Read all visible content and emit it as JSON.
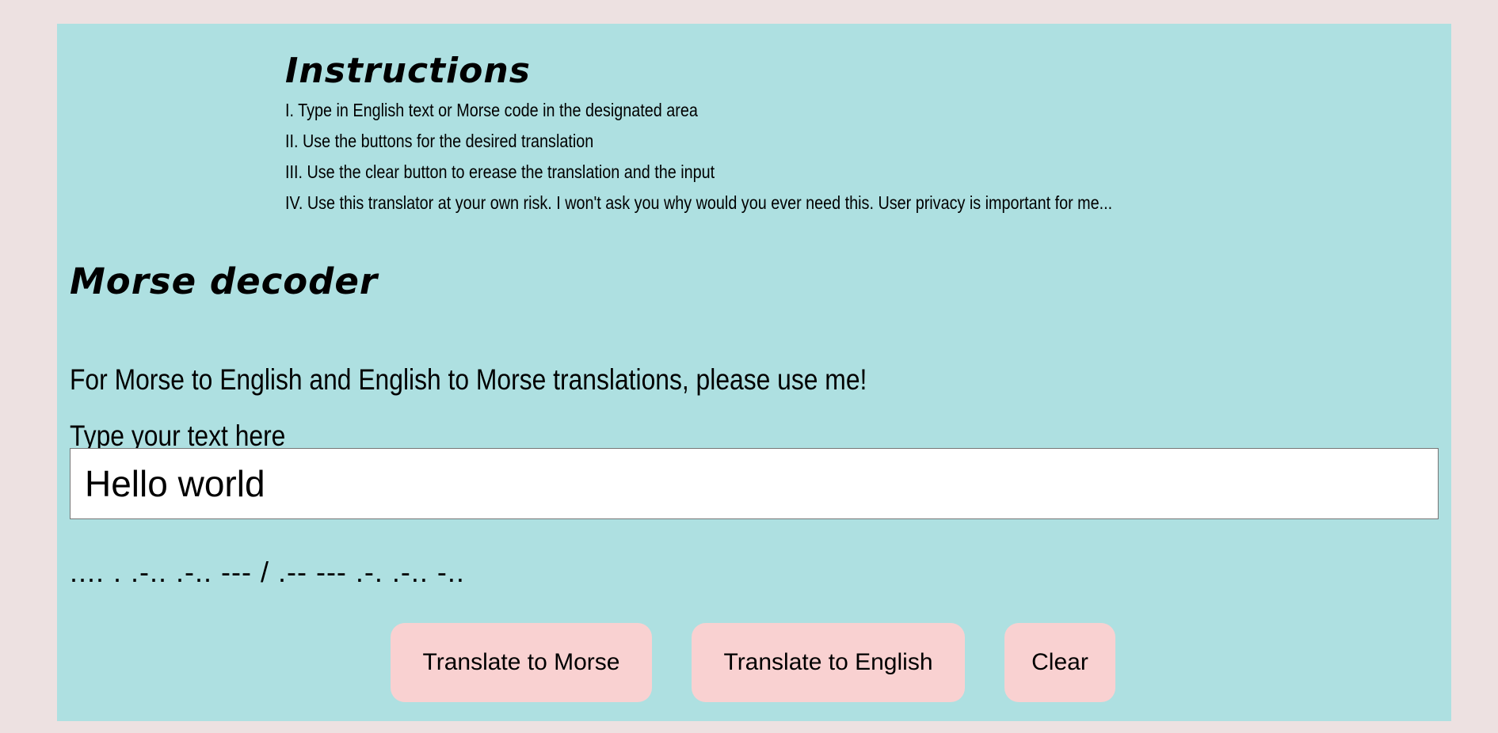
{
  "instructions": {
    "title": "Instructions",
    "items": [
      "I. Type in English text or Morse code in the designated area",
      "II. Use the buttons for the desired translation",
      "III. Use the clear button to erease the translation and the input",
      "IV. Use this translator at your own risk. I won't ask you why would you ever need this. User privacy is important for me..."
    ]
  },
  "decoder": {
    "title": "Morse decoder",
    "subtitle": "For Morse to English and English to Morse translations, please use me!",
    "input_label": "Type your text here",
    "input_value": "Hello world",
    "output": ".... . .-.. .-.. --- / .-- --- .-. .-.. -..",
    "buttons": {
      "to_morse": "Translate to Morse",
      "to_english": "Translate to English",
      "clear": "Clear"
    }
  },
  "colors": {
    "page_background": "#ede1e1",
    "panel_background": "#aee0e1",
    "button_background": "#f9d1d1"
  }
}
